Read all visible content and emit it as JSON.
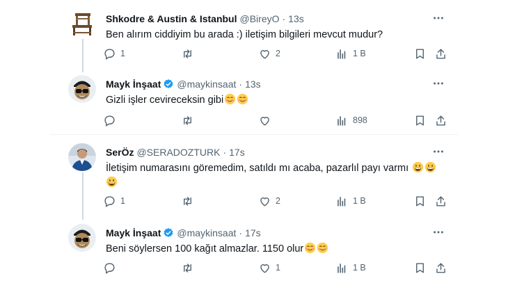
{
  "threads": [
    {
      "tweets": [
        {
          "name": "Shkodre & Austin & Istanbul",
          "handle": "@BireyO",
          "time": "13s",
          "text": "Ben alırım ciddiyim bu arada :) iletişim bilgileri mevcut mudur?",
          "avatar": "chair-avatar",
          "verified": false,
          "stats": {
            "replies": "1",
            "reposts": "",
            "likes": "2",
            "views": "1 B"
          }
        },
        {
          "name": "Mayk İnşaat",
          "handle": "@maykinsaat",
          "time": "13s",
          "text": "Gizli işler cevireceksin gibi",
          "emojis": [
            "smiling-face-icon",
            "smiling-face-icon"
          ],
          "avatar": "cartoon-avatar",
          "verified": true,
          "stats": {
            "replies": "",
            "reposts": "",
            "likes": "",
            "views": "898"
          }
        }
      ]
    },
    {
      "tweets": [
        {
          "name": "SerÖz",
          "handle": "@SERADOZTURK",
          "time": "17s",
          "text": "İletişim numarasını göremedim, satıldı mı acaba, pazarlıl payı varmı",
          "emojis": [
            "grinning-face-icon",
            "grinning-face-icon",
            "grinning-face-icon"
          ],
          "avatar": "photo-avatar",
          "verified": false,
          "stats": {
            "replies": "1",
            "reposts": "",
            "likes": "2",
            "views": "1 B"
          }
        },
        {
          "name": "Mayk İnşaat",
          "handle": "@maykinsaat",
          "time": "17s",
          "text": "Beni söylersen 100 kağıt almazlar. 1150 olur",
          "emojis": [
            "smiling-face-icon",
            "smiling-face-icon"
          ],
          "avatar": "cartoon-avatar",
          "verified": true,
          "stats": {
            "replies": "",
            "reposts": "",
            "likes": "1",
            "views": "1 B"
          }
        }
      ]
    }
  ],
  "colors": {
    "text": "#0f1419",
    "secondary": "#536471",
    "verified": "#1d9bf0",
    "divider": "#eff3f4",
    "thread_line": "#cfd9de"
  }
}
